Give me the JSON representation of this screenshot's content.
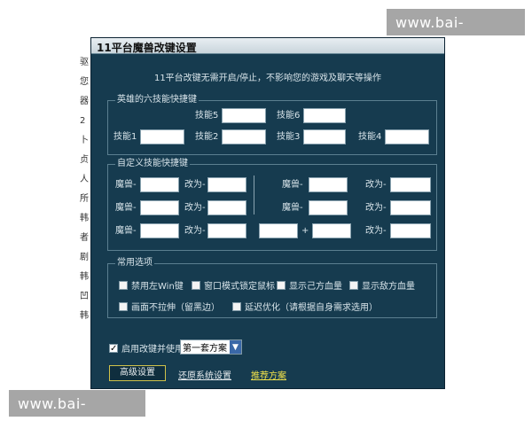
{
  "watermark": "www.bai-yan.com",
  "window": {
    "title": "11平台魔兽改键设置"
  },
  "info_text": "11平台改键无需开启/停止，不影响您的游戏及聊天等操作",
  "hero_section": {
    "title": "英雄的六技能快捷键",
    "skill5": "技能5",
    "skill6": "技能6",
    "skill1": "技能1",
    "skill2": "技能2",
    "skill3": "技能3",
    "skill4": "技能4"
  },
  "custom_section": {
    "title": "自定义技能快捷键",
    "from_label": "魔兽-",
    "to_label": "改为-",
    "plus": "+"
  },
  "options_section": {
    "title": "常用选项",
    "opt_disable_win": "禁用左Win键",
    "opt_window_lock": "窗口模式锁定鼠标",
    "opt_self_hp": "显示己方血量",
    "opt_enemy_hp": "显示敌方血量",
    "opt_no_stretch": "画面不拉伸（留黑边）",
    "opt_latency": "延迟优化（请根据自身需求选用）"
  },
  "enable": {
    "label": "启用改键并使用",
    "checked": true,
    "selected_scheme": "第一套方案"
  },
  "buttons": {
    "advanced": "高级设置",
    "restore": "还原系统设置",
    "recommend": "推荐方案"
  },
  "colors": {
    "window_bg": "#163b4f",
    "link_white": "#e7ecef",
    "link_yellow": "#f2e24a",
    "border": "#5b7f90"
  },
  "left_fragments": [
    "驱",
    "您",
    "器",
    "2",
    "卜",
    "贞",
    "人",
    "所",
    "韩",
    "者",
    "剧",
    "韩",
    "凹",
    "韩"
  ]
}
